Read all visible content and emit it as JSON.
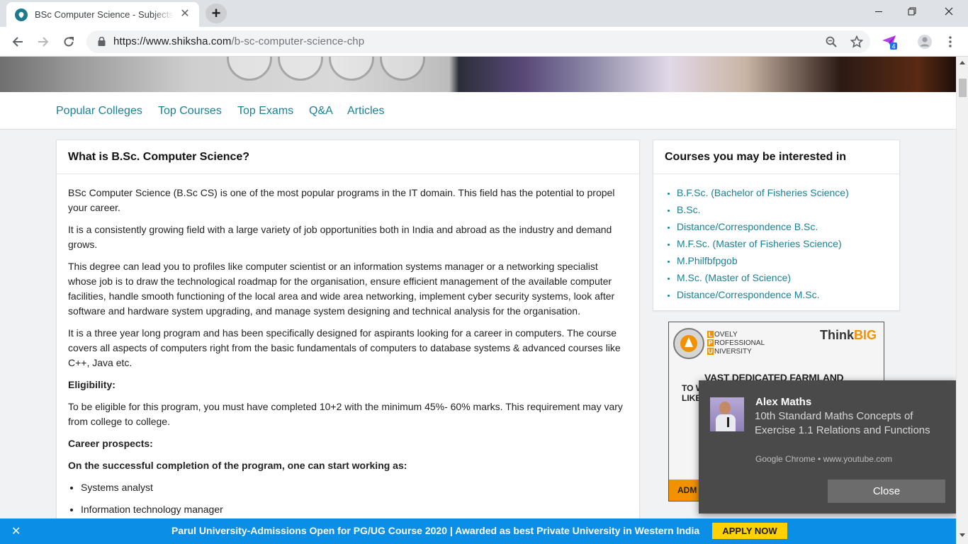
{
  "browser": {
    "tab_title": "BSc Computer Science - Subjects",
    "tab_close": "✕",
    "new_tab": "+",
    "url_host": "https://www.shiksha.com",
    "url_path": "/b-sc-computer-science-chp",
    "extension_badge": "4"
  },
  "subnav": {
    "items": [
      "Popular Colleges",
      "Top Courses",
      "Top Exams",
      "Q&A",
      "Articles"
    ]
  },
  "article": {
    "heading": "What is B.Sc. Computer Science?",
    "p1": "BSc Computer Science (B.Sc CS) is one of the most popular programs in the IT domain. This field has the potential to propel your career.",
    "p2": "It is a consistently growing field with a large variety of job opportunities both in India and abroad as the industry and demand grows.",
    "p3": "This degree can lead you to profiles like computer scientist or an information systems manager or a networking specialist whose job is to draw the technological roadmap for the organisation, ensure efficient management of the available computer facilities, handle smooth functioning of the local area and wide area networking, implement cyber security systems, look after software and hardware system upgrading, and manage system designing and technical analysis for the organisation.",
    "p4": "It is a three year long program and has been specifically designed for aspirants looking for a career in computers. The course covers all aspects of computers right from the basic fundamentals of computers to database systems & advanced courses like C++, Java etc.",
    "eligibility_label": "Eligibility:",
    "p5": "To be eligible for this program, you must have completed 10+2 with the minimum 45%- 60% marks. This requirement may vary from college to college.",
    "career_label": "Career prospects:",
    "career_intro": "On the successful completion of the program, one can start working as:",
    "jobs": [
      "Systems analyst",
      "Information technology manager"
    ]
  },
  "courses": {
    "heading": "Courses you may be interested in",
    "items": [
      "B.F.Sc. (Bachelor of Fisheries Science)",
      "B.Sc.",
      "Distance/Correspondence B.Sc.",
      "M.F.Sc. (Master of Fisheries Science)",
      "M.Philfbfpgob",
      "M.Sc. (Master of Science)",
      "Distance/Correspondence M.Sc."
    ]
  },
  "ad": {
    "lpu_line1": "OVELY",
    "lpu_line2": "ROFESSIONAL",
    "lpu_line3": "NIVERSITY",
    "lpu_letters": [
      "L",
      "P",
      "U"
    ],
    "think": "Think",
    "big": "BIG",
    "headline": "VAST DEDICATED FARMLAND",
    "sub1": "TO W",
    "sub2": "LIKE",
    "foot": "ADM"
  },
  "notification": {
    "title": "Alex Maths",
    "message": "10th Standard Maths Concepts of Exercise 1.1 Relations and Functions",
    "source": "Google Chrome • www.youtube.com",
    "close_label": "Close"
  },
  "banner": {
    "close": "✕",
    "text": "Parul University-Admissions Open for PG/UG Course 2020 | Awarded as best Private University in Western India",
    "cta": "APPLY NOW"
  },
  "colors": {
    "link": "#1b7f95",
    "banner": "#0b8fe6",
    "cta": "#ffd100",
    "toast": "#4a4a4a"
  }
}
